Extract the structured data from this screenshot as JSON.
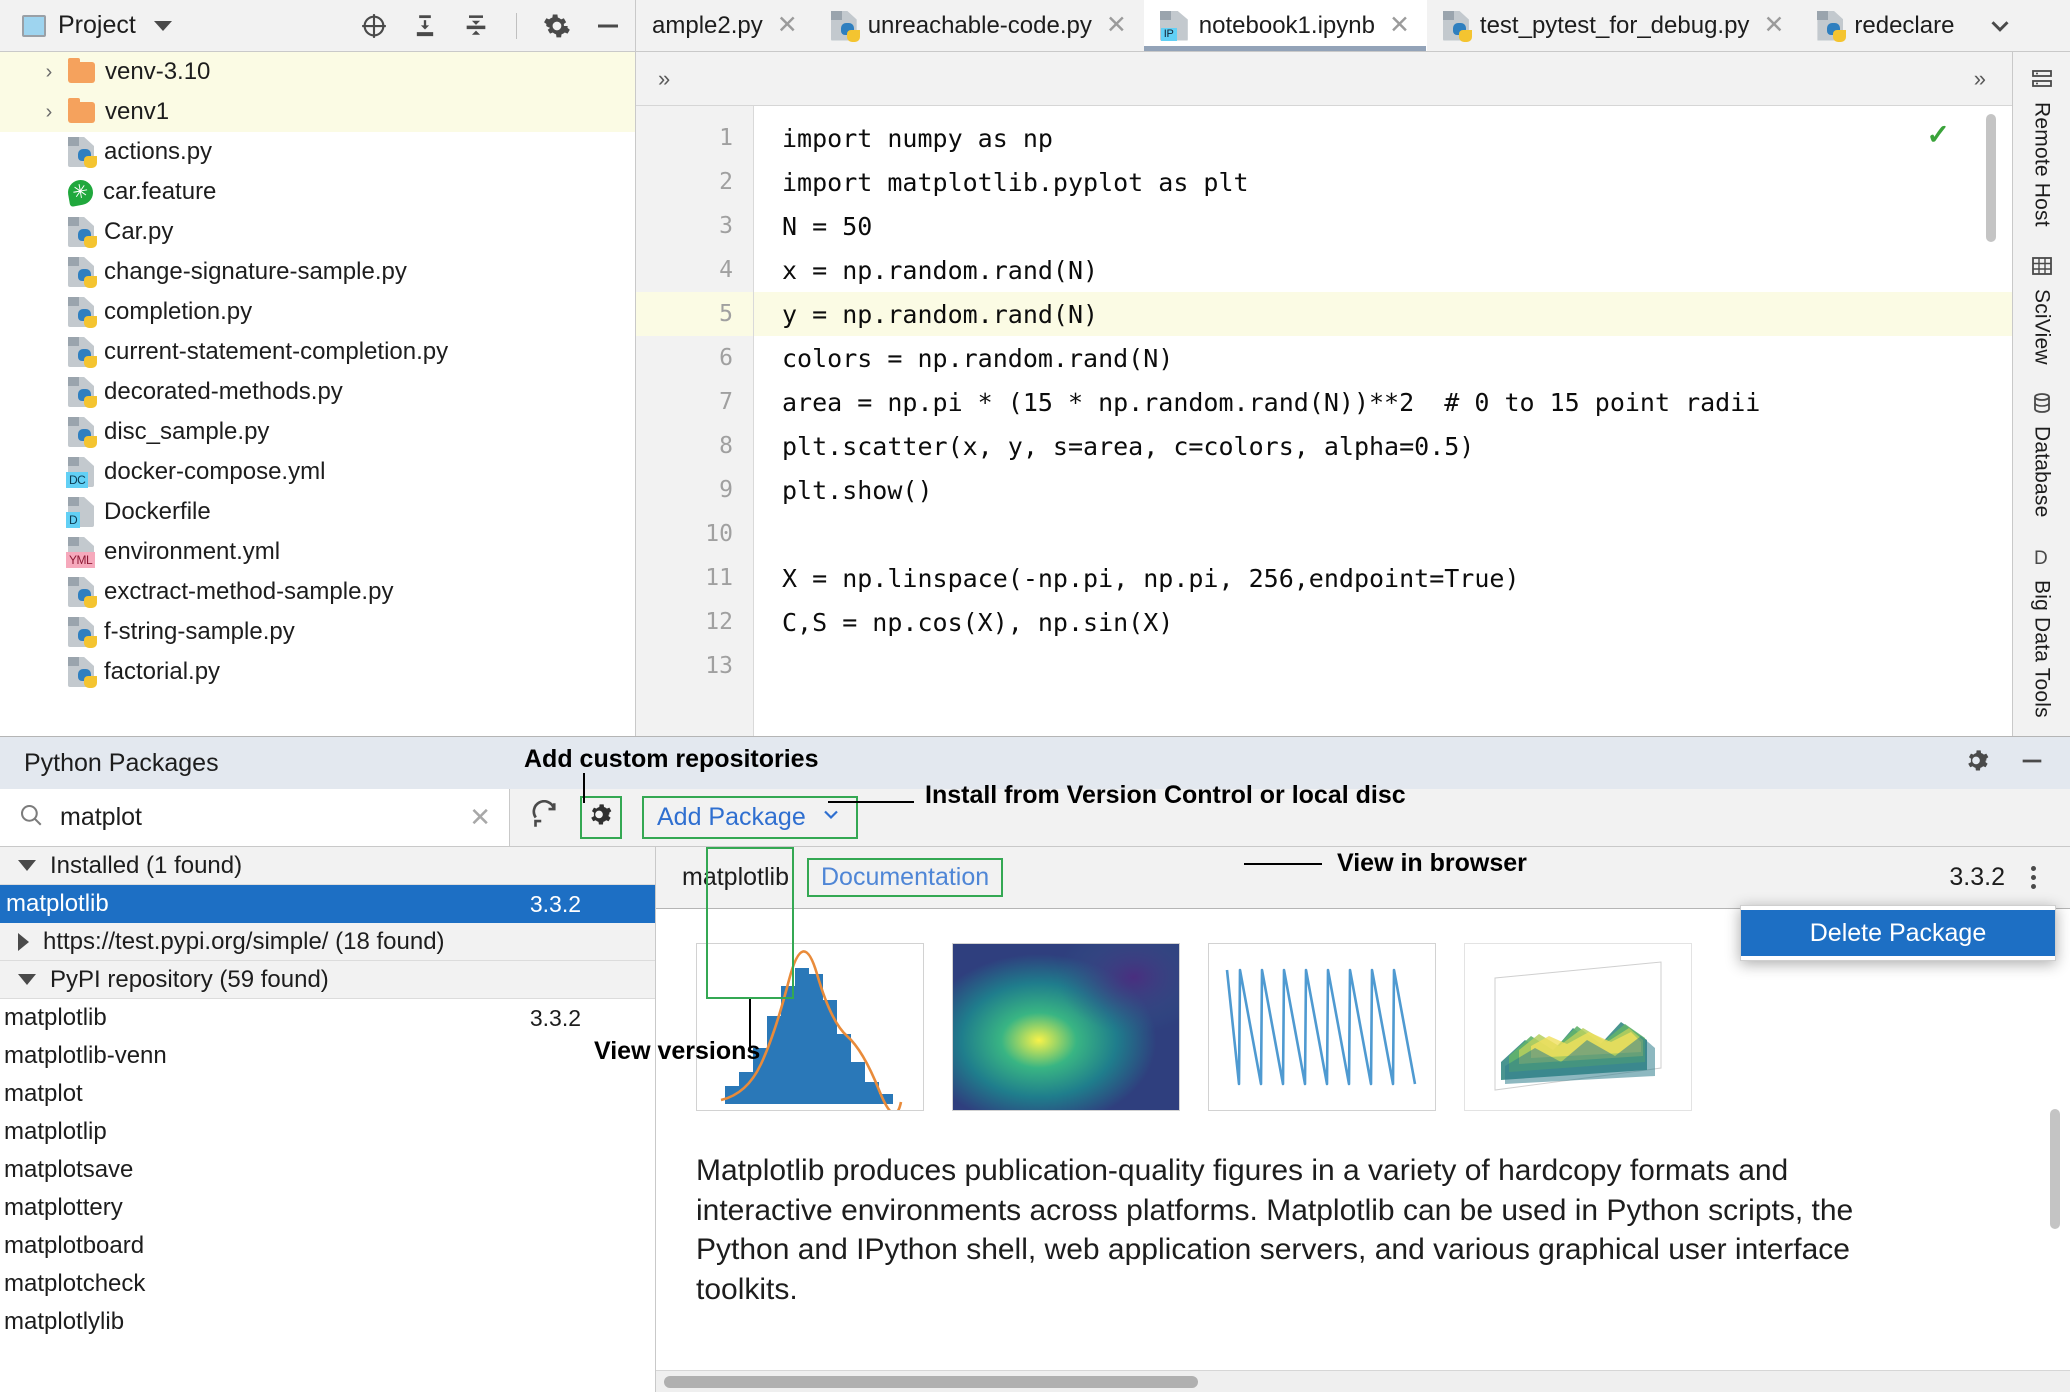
{
  "project_panel": {
    "title": "Project",
    "tools": [
      "locate-icon",
      "expand-all-icon",
      "collapse-all-icon",
      "settings-icon",
      "hide-icon"
    ],
    "items": [
      {
        "label": "venv-3.10",
        "icon": "folder-icon",
        "arrow": "›",
        "selected": true
      },
      {
        "label": "venv1",
        "icon": "folder-icon",
        "arrow": "›",
        "selected": true
      },
      {
        "label": "actions.py",
        "icon": "python-file-icon"
      },
      {
        "label": "car.feature",
        "icon": "cucumber-feature-icon"
      },
      {
        "label": "Car.py",
        "icon": "python-file-icon"
      },
      {
        "label": "change-signature-sample.py",
        "icon": "python-file-icon"
      },
      {
        "label": "completion.py",
        "icon": "python-file-icon"
      },
      {
        "label": "current-statement-completion.py",
        "icon": "python-file-icon"
      },
      {
        "label": "decorated-methods.py",
        "icon": "python-file-icon"
      },
      {
        "label": "disc_sample.py",
        "icon": "python-file-icon"
      },
      {
        "label": "docker-compose.yml",
        "icon": "docker-compose-file-icon",
        "badge": "DC"
      },
      {
        "label": "Dockerfile",
        "icon": "dockerfile-icon",
        "badge": "D"
      },
      {
        "label": "environment.yml",
        "icon": "yaml-file-icon",
        "badge": "YML"
      },
      {
        "label": "exctract-method-sample.py",
        "icon": "python-file-icon"
      },
      {
        "label": "f-string-sample.py",
        "icon": "python-file-icon"
      },
      {
        "label": "factorial.py",
        "icon": "python-file-icon"
      }
    ]
  },
  "tabs": [
    {
      "label": "ample2.py",
      "icon": "none",
      "active": false,
      "clipped": true
    },
    {
      "label": "unreachable-code.py",
      "icon": "python-file-icon",
      "active": false
    },
    {
      "label": "notebook1.ipynb",
      "icon": "jupyter-notebook-icon",
      "active": true
    },
    {
      "label": "test_pytest_for_debug.py",
      "icon": "python-file-icon",
      "active": false
    },
    {
      "label": "redeclare",
      "icon": "python-file-icon",
      "active": false,
      "clipped": true
    }
  ],
  "editor": {
    "collapse_chevron": "»",
    "expand_chevron": "»",
    "status_icon": "checkmark-icon",
    "current_line": 5,
    "lines": [
      {
        "n": "1",
        "text": "import numpy as np"
      },
      {
        "n": "2",
        "text": "import matplotlib.pyplot as plt"
      },
      {
        "n": "3",
        "text": "N = 50"
      },
      {
        "n": "4",
        "text": "x = np.random.rand(N)"
      },
      {
        "n": "5",
        "text": "y = np.random.rand(N)"
      },
      {
        "n": "6",
        "text": "colors = np.random.rand(N)"
      },
      {
        "n": "7",
        "text": "area = np.pi * (15 * np.random.rand(N))**2  # 0 to 15 point radii"
      },
      {
        "n": "8",
        "text": "plt.scatter(x, y, s=area, c=colors, alpha=0.5)"
      },
      {
        "n": "9",
        "text": "plt.show()"
      },
      {
        "n": "10",
        "text": ""
      },
      {
        "n": "11",
        "text": "X = np.linspace(-np.pi, np.pi, 256,endpoint=True)"
      },
      {
        "n": "12",
        "text": "C,S = np.cos(X), np.sin(X)"
      },
      {
        "n": "13",
        "text": ""
      }
    ]
  },
  "packages": {
    "panel_title": "Python Packages",
    "settings_icon": "gear-icon",
    "hide_icon": "minimize-icon",
    "search": {
      "value": "matplot",
      "placeholder": "Search",
      "icon": "search-icon",
      "clear_icon": "close-icon"
    },
    "refresh_icon": "refresh-icon",
    "repo_settings_icon": "gear-icon",
    "add_package_label": "Add Package",
    "add_package_caret": "chevron-down-icon",
    "groups": [
      {
        "label": "Installed (1 found)",
        "expanded": true,
        "items": [
          {
            "name": "matplotlib",
            "version": "3.3.2",
            "selected": true
          }
        ]
      },
      {
        "label": "https://test.pypi.org/simple/ (18 found)",
        "expanded": false,
        "items": []
      },
      {
        "label": "PyPI repository (59 found)",
        "expanded": true,
        "items": [
          {
            "name": "matplotlib",
            "version": "3.3.2",
            "selected": false
          },
          {
            "name": "matplotlib-venn",
            "version": "",
            "selected": false
          },
          {
            "name": "matplot",
            "version": "",
            "selected": false
          },
          {
            "name": "matplotlip",
            "version": "",
            "selected": false
          },
          {
            "name": "matplotsave",
            "version": "",
            "selected": false
          },
          {
            "name": "matplottery",
            "version": "",
            "selected": false
          },
          {
            "name": "matplotboard",
            "version": "",
            "selected": false
          },
          {
            "name": "matplotcheck",
            "version": "",
            "selected": false
          },
          {
            "name": "matplotlylib",
            "version": "",
            "selected": false
          }
        ]
      }
    ],
    "detail": {
      "name": "matplotlib",
      "documentation_label": "Documentation",
      "version": "3.3.2",
      "kebab_icon": "more-options-icon",
      "context_menu": [
        {
          "label": "Delete Package",
          "highlighted": true
        }
      ],
      "description": "Matplotlib produces publication-quality figures in a variety of hardcopy formats and interactive environments across platforms. Matplotlib can be used in Python scripts, the Python and IPython shell, web application servers, and various graphical user interface toolkits.",
      "thumbnails": [
        "histogram-plot",
        "heatmap-plot",
        "spikes-line-plot",
        "3d-surface-plot"
      ]
    }
  },
  "annotations": [
    {
      "text": "Add custom repositories",
      "id": "ann-add-custom-repos"
    },
    {
      "text": "Install from Version Control or local disc",
      "id": "ann-install-from-vcs"
    },
    {
      "text": "View in browser",
      "id": "ann-view-in-browser"
    },
    {
      "text": "View versions",
      "id": "ann-view-versions"
    }
  ],
  "right_rail": [
    {
      "label": "Remote Host",
      "icon": "remote-host-icon"
    },
    {
      "label": "SciView",
      "icon": "sciview-icon"
    },
    {
      "label": "Database",
      "icon": "database-icon"
    },
    {
      "label": "Big Data Tools",
      "icon": "big-data-tools-icon"
    }
  ],
  "colors": {
    "accent": "#1d6fc4",
    "annotation_box": "#34a853",
    "link": "#2f6fd0",
    "selected_row": "#fbfbe4"
  }
}
